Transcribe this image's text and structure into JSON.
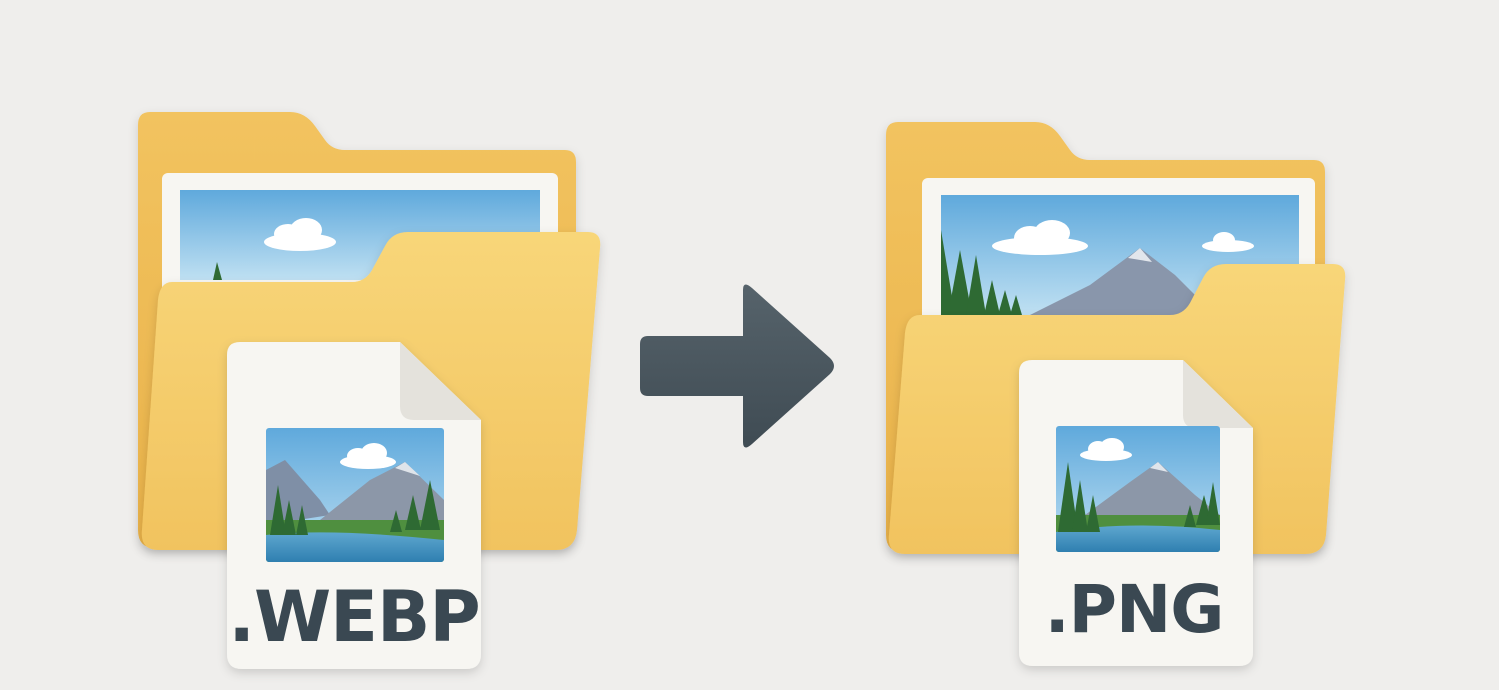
{
  "source_file": {
    "extension": ".WEBP",
    "icon": "folder-icon"
  },
  "target_file": {
    "extension": ".PNG",
    "icon": "folder-icon"
  },
  "arrow": {
    "icon": "arrow-right-icon",
    "color": "#4a565e"
  },
  "colors": {
    "background": "#efeeec",
    "folder": "#f4c766",
    "label_text": "#3a4852"
  }
}
